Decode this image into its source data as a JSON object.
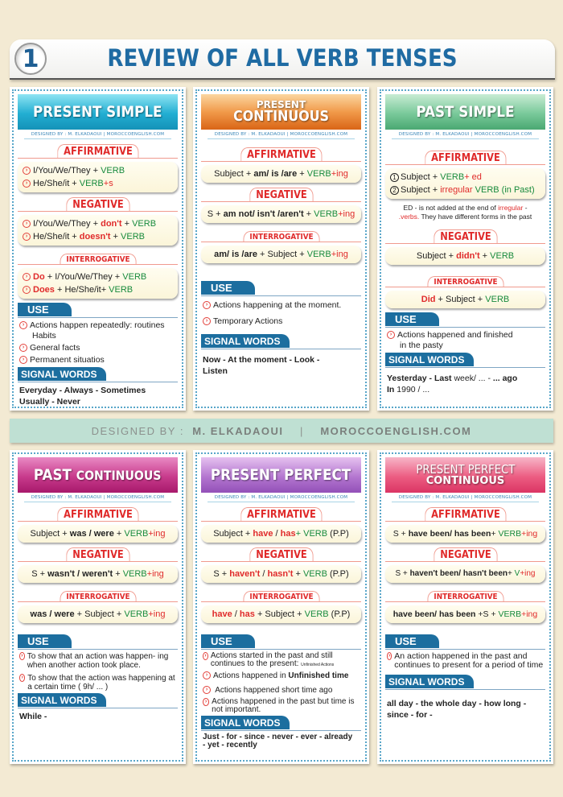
{
  "header": {
    "number": "1",
    "title": "REVIEW OF ALL VERB TENSES"
  },
  "credit": {
    "designed_by_label": "DESIGNED BY :",
    "author": "M. ELKADAOUI",
    "separator": "|",
    "site": "MOROCCOENGLISH.COM",
    "card_credit": "DESIGNED BY : M. ELKADAOUI | MOROCCOENGLISH.COM"
  },
  "labels": {
    "affirmative": "AFFIRMATIVE",
    "negative": "NEGATIVE",
    "interrogative": "INTERROGATIVE",
    "use": "USE",
    "signal_words": "SIGNAL WORDS",
    "arrow_glyph": "›"
  },
  "colors": {
    "title_blue": "#1f6ba3",
    "section_red": "#e02b2b",
    "verb_green": "#178a3c",
    "tab_blue": "#1c6e9f",
    "background": "#f3ead3"
  },
  "cards": {
    "present_simple": {
      "title": "PRESENT SIMPLE",
      "affirmative": [
        {
          "p1": "I/You/We/They + ",
          "verb": "VERB",
          "suffix": ""
        },
        {
          "p1": "He/She/it + ",
          "verb": "VERB",
          "suffix": "+s"
        }
      ],
      "negative": [
        {
          "p1": "I/You/We/They + ",
          "aux": "don't",
          "p2": " + ",
          "verb": "VERB"
        },
        {
          "p1": "He/She/it + ",
          "aux": "doesn't",
          "p2": " + ",
          "verb": "VERB"
        }
      ],
      "interrogative": [
        {
          "aux": "Do",
          "p1": " + I/You/We/They + ",
          "verb": "VERB"
        },
        {
          "aux": "Does",
          "p1": " + He/She/it+ ",
          "verb": "VERB"
        }
      ],
      "use": [
        "Actions happen repeatedly: routines",
        "Habits",
        "General facts",
        "Permanent situatios"
      ],
      "signal_words": [
        "Everyday - Always - Sometimes",
        "Usually - Never"
      ]
    },
    "present_continuous": {
      "title_top": "PRESENT",
      "title_bottom": "CONTINUOUS",
      "affirmative": {
        "p1": "Subject + ",
        "aux": "am/ is /are",
        "p2": " + ",
        "verb": "VERB",
        "suffix": "+ing"
      },
      "negative": {
        "p1": "S + ",
        "aux": "am not/ isn't /aren't",
        "p2": " + ",
        "verb": "VERB",
        "suffix": "+ing"
      },
      "interrogative": {
        "aux": "am/ is /are",
        "p1": " + Subject +  ",
        "verb": "VERB",
        "suffix": "+ing"
      },
      "use": [
        "Actions happening at the moment.",
        "Temporary Actions"
      ],
      "signal_words": [
        "Now - At the moment - Look -",
        "Listen"
      ]
    },
    "past_simple": {
      "title": "PAST SIMPLE",
      "affirmative": [
        {
          "num": "1",
          "p1": "Subject +  ",
          "verb": "VERB",
          "suffix": "+ ed"
        },
        {
          "num": "2",
          "p1": "Subject + ",
          "irregular": "irregular",
          "verb": " VERB (in Past)"
        }
      ],
      "note_1": "ED - is not added at the end of ",
      "note_irregular": "irregular",
      "note_2": " -",
      "note_verbs": ".verbs.",
      "note_3": " They have different forms in the past",
      "negative": {
        "p1": "Subject + ",
        "aux": "didn't",
        "p2": " + ",
        "verb": "VERB"
      },
      "interrogative": {
        "aux": "Did",
        "p1": " + Subject +  ",
        "verb": "VERB"
      },
      "use": [
        "Actions happened and finished",
        "in the pasty"
      ],
      "signal_words": {
        "line1_a": "Yesterday  - Last",
        "line1_b": " week/ ... - ",
        "line1_c": " ... ago",
        "line2_a": "In",
        "line2_b": " 1990 / ..."
      }
    },
    "past_continuous": {
      "title_a": "PAST",
      "title_b": "CONTINUOUS",
      "affirmative": {
        "p1": "Subject + ",
        "aux": "was / were",
        "p2": " + ",
        "verb": "VERB",
        "suffix": "+ing"
      },
      "negative": {
        "p1": "S +  ",
        "aux": "wasn't / weren't",
        "p2": " + ",
        "verb": "VERB",
        "suffix": "+ing"
      },
      "interrogative": {
        "aux": "was / were",
        "p1": "  + Subject +  ",
        "verb": "VERB",
        "suffix": "+ing"
      },
      "use": [
        "To show that an action was happen- ing  when another action took place.",
        "To show that the action was happening at a certain time ( 9h/ ... )"
      ],
      "signal_words": [
        "While  -"
      ]
    },
    "present_perfect": {
      "title": "PRESENT PERFECT",
      "affirmative": {
        "p1": "Subject + ",
        "aux": "have",
        "sep": " / ",
        "aux2": "has",
        "p2": "+ ",
        "verb": "VERB",
        "tail": " (P.P)"
      },
      "negative": {
        "p1": "S + ",
        "aux": "haven't",
        "sep": " / ",
        "aux2": "hasn't",
        "p2": " + ",
        "verb": "VERB",
        "tail": " (P.P)"
      },
      "interrogative": {
        "aux": "have",
        "sep": " / ",
        "aux2": "has",
        "p1": " + Subject +  ",
        "verb": "VERB",
        "tail": " (P.P)"
      },
      "use": [
        {
          "text": "Actions started in the past and still continues to the present: ",
          "small": "Unfinished Actions"
        },
        {
          "text": "Actions happened in ",
          "bold": "Unfinished time"
        },
        {
          "text": " Actions happened short time ago"
        },
        {
          "text": "Actions happened in the past but time is not important."
        }
      ],
      "signal_words": [
        "Just - for - since - never - ever - already",
        "- yet - recently"
      ]
    },
    "present_perfect_continuous": {
      "title_top": "PRESENT PERFECT",
      "title_bottom": "CONTINUOUS",
      "affirmative": {
        "p1": "S + ",
        "aux": "have been/ has been",
        "p2": "+ ",
        "verb": "VERB",
        "suffix": "+ing"
      },
      "negative": {
        "p1": "S + ",
        "aux": "haven't been/ hasn't been",
        "p2": "+ ",
        "verb": "V",
        "suffix": "+ing"
      },
      "interrogative": {
        "aux": "have been/ has been",
        "p1": " +S + ",
        "verb": "VERB",
        "suffix": "+ing"
      },
      "use": [
        "An action happened in the past and continues to present for a period of time"
      ],
      "signal_words": [
        "all day - the whole day - how long -",
        "since - for -"
      ]
    }
  }
}
